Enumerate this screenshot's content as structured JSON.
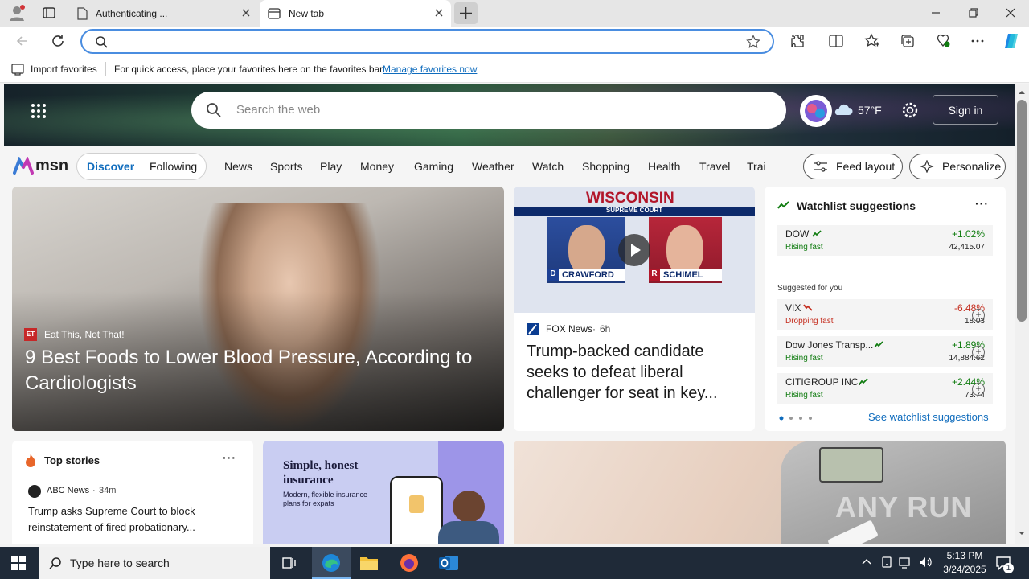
{
  "browser": {
    "tabs": [
      {
        "title": "Authenticating ...",
        "active": false
      },
      {
        "title": "New tab",
        "active": true
      }
    ],
    "address_value": "",
    "favorites_bar": {
      "import_label": "Import favorites",
      "message": "For quick access, place your favorites here on the favorites bar.",
      "manage_link": "Manage favorites now"
    }
  },
  "msn": {
    "search_placeholder": "Search the web",
    "weather_temp": "57°F",
    "sign_in": "Sign in",
    "logo": "msn",
    "feed_tabs": [
      "Discover",
      "Following"
    ],
    "nav_links": [
      "News",
      "Sports",
      "Play",
      "Money",
      "Gaming",
      "Weather",
      "Watch",
      "Shopping",
      "Health",
      "Travel",
      "Trai"
    ],
    "feed_layout": "Feed layout",
    "personalize": "Personalize",
    "hero": {
      "source": "Eat This, Not That!",
      "headline": "9 Best Foods to Lower Blood Pressure, According to Cardiologists"
    },
    "video_card": {
      "banner": "WISCONSIN",
      "sub_banner": "SUPREME COURT",
      "left_name": "CRAWFORD",
      "left_tag": "D",
      "right_name": "SCHIMEL",
      "right_tag": "R",
      "source": "FOX News",
      "age": "6h",
      "headline": "Trump-backed candidate seeks to defeat liberal challenger for seat in key..."
    },
    "watchlist": {
      "title": "Watchlist suggestions",
      "featured": {
        "name": "DOW",
        "status": "Rising fast",
        "change": "+1.02%",
        "price": "42,415.07"
      },
      "suggested_label": "Suggested for you",
      "suggestions": [
        {
          "name": "VIX",
          "status": "Dropping fast",
          "change": "-6.48%",
          "price": "18.03"
        },
        {
          "name": "Dow Jones Transp...",
          "status": "Rising fast",
          "change": "+1.89%",
          "price": "14,884.62"
        },
        {
          "name": "CITIGROUP INC.",
          "status": "Rising fast",
          "change": "+2.44%",
          "price": "73.74"
        }
      ],
      "see_link": "See watchlist suggestions"
    },
    "top_stories": {
      "title": "Top stories",
      "source": "ABC News",
      "age": "34m",
      "headline": "Trump asks Supreme Court to block reinstatement of fired probationary..."
    },
    "ad": {
      "title": "Simple, honest insurance",
      "body": "Modern, flexible insurance plans for expats"
    },
    "watermark": "ANY RUN"
  },
  "taskbar": {
    "search_placeholder": "Type here to search",
    "time": "5:13 PM",
    "date": "3/24/2025",
    "notification_count": "1"
  },
  "colors": {
    "accent": "#0f6cbd",
    "rising": "#107c10",
    "dropping": "#c42b1c",
    "taskbar": "#1f2a38"
  }
}
